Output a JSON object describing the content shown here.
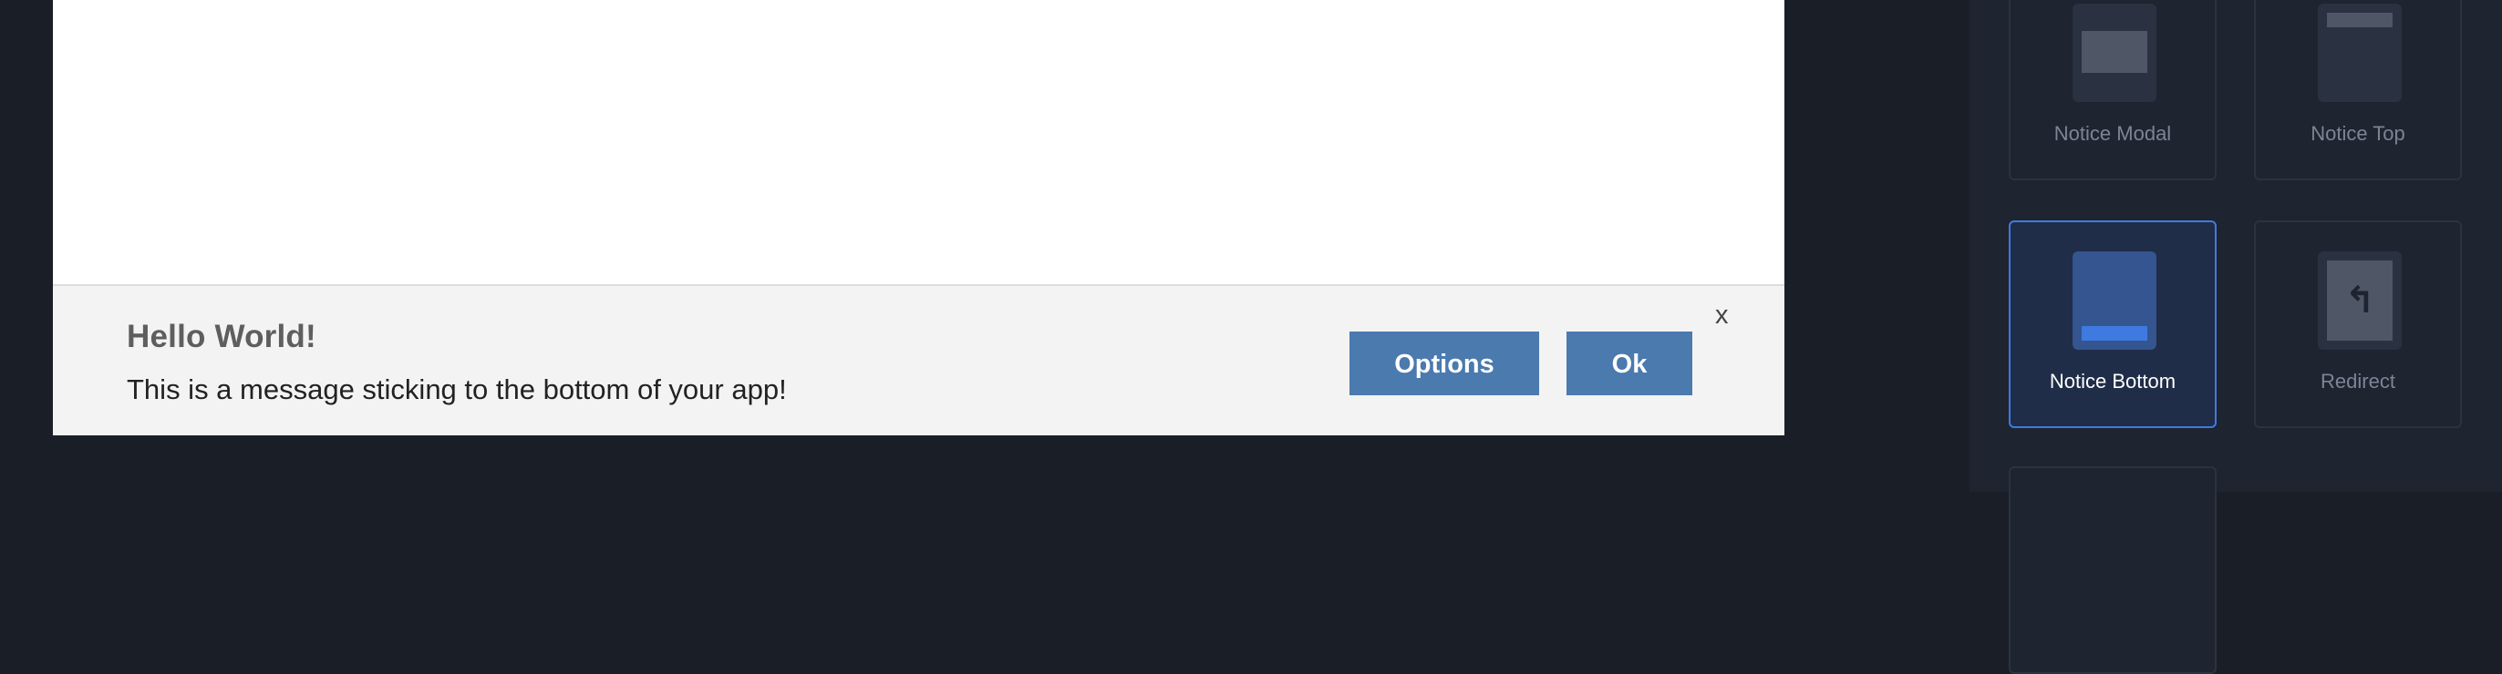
{
  "notice": {
    "title": "Hello World!",
    "message": "This is a message sticking to the bottom of your app!",
    "options_label": "Options",
    "ok_label": "Ok",
    "close_label": "x"
  },
  "templates": {
    "items": [
      {
        "label": "Notice Modal",
        "icon": "notice-modal-icon"
      },
      {
        "label": "Notice Top",
        "icon": "notice-top-icon"
      },
      {
        "label": "Notice Bottom",
        "icon": "notice-bottom-icon",
        "selected": true
      },
      {
        "label": "Redirect",
        "icon": "redirect-icon"
      }
    ]
  },
  "colors": {
    "accent": "#3f7ae0",
    "button": "#4a7aae",
    "background": "#1a1f27"
  }
}
